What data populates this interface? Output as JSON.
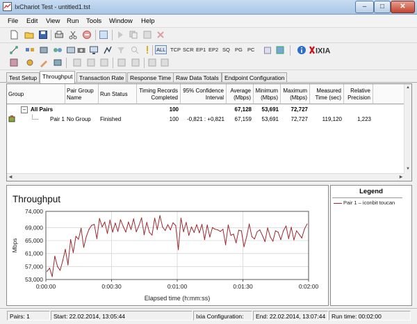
{
  "window": {
    "title": "IxChariot Test - untitled1.tst",
    "minimize": "–",
    "maximize": "□",
    "close": "✕"
  },
  "menu": [
    "File",
    "Edit",
    "View",
    "Run",
    "Tools",
    "Window",
    "Help"
  ],
  "toolbar2": {
    "all": "ALL",
    "tcp": "TCP",
    "scr": "SCR",
    "ep1": "EP1",
    "ep2": "EP2",
    "sq": "SQ",
    "pg": "PG",
    "pc": "PC",
    "brand": "IXIA"
  },
  "tabs": [
    "Test Setup",
    "Throughput",
    "Transaction Rate",
    "Response Time",
    "Raw Data Totals",
    "Endpoint Configuration"
  ],
  "table": {
    "headers": {
      "group": "Group",
      "pair_group_name": "Pair Group Name",
      "run_status": "Run Status",
      "timing_records": "Timing Records Completed",
      "confidence": "95% Confidence Interval",
      "average": "Average (Mbps)",
      "minimum": "Minimum (Mbps)",
      "maximum": "Maximum (Mbps)",
      "measured": "Measured Time (sec)",
      "precision": "Relative Precision"
    },
    "all_pairs": {
      "expander": "–",
      "label": "All Pairs",
      "timing_records": "100",
      "average": "67,128",
      "minimum": "53,691",
      "maximum": "72,727"
    },
    "pair1": {
      "label": "Pair 1",
      "pair_group_name": "No Group",
      "run_status": "Finished",
      "timing_records": "100",
      "confidence": "-0,821 : +0,821",
      "average": "67,159",
      "minimum": "53,691",
      "maximum": "72,727",
      "measured": "119,120",
      "precision": "1,223"
    }
  },
  "chart_data": {
    "type": "line",
    "title": "Throughput",
    "xlabel": "Elapsed time (h:mm:ss)",
    "ylabel": "Mbps",
    "ylim": [
      53000,
      74000
    ],
    "xlim": [
      0,
      120
    ],
    "y_ticks": [
      "53,000",
      "57,000",
      "61,000",
      "65,000",
      "69,000",
      "74,000"
    ],
    "y_tick_values": [
      53000,
      57000,
      61000,
      65000,
      69000,
      74000
    ],
    "x_ticks": [
      "0:00:00",
      "0:00:30",
      "0:01:00",
      "0:01:30",
      "0:02:00"
    ],
    "x_tick_values": [
      0,
      30,
      60,
      90,
      120
    ],
    "grid": true,
    "series": [
      {
        "name": "Pair 1 – iconbit toucan",
        "color": "#9a2a30",
        "x": [
          0.5,
          1.7,
          2.9,
          4.1,
          5.3,
          6.5,
          7.7,
          8.9,
          10.1,
          11.3,
          12.5,
          13.7,
          14.9,
          16.1,
          17.3,
          18.5,
          19.7,
          20.9,
          22.1,
          23.3,
          24.5,
          25.7,
          26.9,
          28.1,
          29.3,
          30.5,
          31.7,
          32.9,
          34.1,
          35.3,
          36.5,
          37.7,
          38.9,
          40.1,
          41.3,
          42.5,
          43.7,
          44.9,
          46.1,
          47.3,
          48.5,
          49.7,
          50.9,
          52.1,
          53.3,
          54.5,
          55.7,
          56.9,
          58.1,
          59.3,
          60.5,
          61.7,
          62.9,
          64.1,
          65.3,
          66.5,
          67.7,
          68.9,
          70.1,
          71.3,
          72.5,
          73.7,
          74.9,
          76.1,
          77.3,
          78.5,
          79.7,
          80.9,
          82.1,
          83.3,
          84.5,
          85.7,
          86.9,
          88.1,
          89.3,
          90.5,
          91.7,
          92.9,
          94.1,
          95.3,
          96.5,
          97.7,
          98.9,
          100.1,
          101.3,
          102.5,
          103.7,
          104.9,
          106.1,
          107.3,
          108.5,
          109.7,
          110.9,
          112.1,
          113.3,
          114.5,
          115.7,
          116.9,
          118.1,
          119.3
        ],
        "values": [
          55500,
          56500,
          53900,
          60200,
          57000,
          55800,
          58800,
          62300,
          57500,
          65300,
          61300,
          66300,
          65400,
          68800,
          62900,
          66300,
          68500,
          69700,
          70000,
          65600,
          71800,
          69200,
          70700,
          67200,
          71300,
          67600,
          70400,
          67800,
          71400,
          69400,
          67600,
          70700,
          68400,
          71700,
          67700,
          69600,
          72000,
          66800,
          70600,
          67500,
          66700,
          71900,
          68400,
          72700,
          69200,
          68100,
          69900,
          68300,
          70500,
          69600,
          62200,
          71900,
          67700,
          70600,
          66600,
          69200,
          67500,
          69900,
          67400,
          70000,
          65300,
          69800,
          66100,
          69000,
          68500,
          68300,
          67800,
          68500,
          63700,
          69800,
          66600,
          67000,
          64300,
          68200,
          68000,
          63100,
          66200,
          70100,
          66200,
          65500,
          67700,
          68300,
          66600,
          64700,
          68900,
          66100,
          64800,
          68000,
          67600,
          65300,
          68000,
          69500,
          65600,
          69100,
          65200,
          68000,
          66900,
          65800,
          68500,
          70100
        ]
      }
    ]
  },
  "legend": {
    "title": "Legend",
    "entry": "Pair 1 – iconbit toucan"
  },
  "status": {
    "pairs": "Pairs: 1",
    "start": "Start: 22.02.2014, 13:05:44",
    "ixia": "Ixia Configuration:",
    "end": "End: 22.02.2014, 13:07:44",
    "runtime": "Run time: 00:02:00"
  }
}
